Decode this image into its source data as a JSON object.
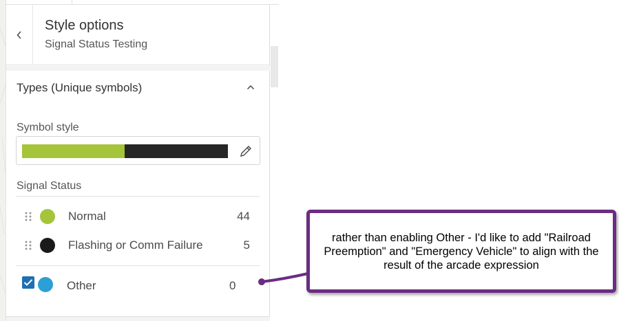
{
  "header": {
    "back_icon": "chevron-left-icon",
    "title": "Style options",
    "subtitle": "Signal Status Testing"
  },
  "section": {
    "title": "Types (Unique symbols)",
    "collapse_icon": "chevron-up-icon"
  },
  "symbol_style": {
    "label": "Symbol style",
    "ramp_colors": [
      "#a6c43a",
      "#262626"
    ],
    "edit_icon": "pencil-icon"
  },
  "field": {
    "label": "Signal Status"
  },
  "categories": [
    {
      "label": "Normal",
      "count": "44",
      "color": "#a6c43a"
    },
    {
      "label": "Flashing or Comm Failure",
      "count": "5",
      "color": "#1a1a1a"
    }
  ],
  "other": {
    "label": "Other",
    "count": "0",
    "color": "#2b9fd6",
    "checked": true
  },
  "annotation": {
    "text": "rather than enabling Other - I'd like to add \"Railroad Preemption\" and \"Emergency Vehicle\" to align with the result of the arcade expression",
    "border_color": "#6b2c82"
  }
}
